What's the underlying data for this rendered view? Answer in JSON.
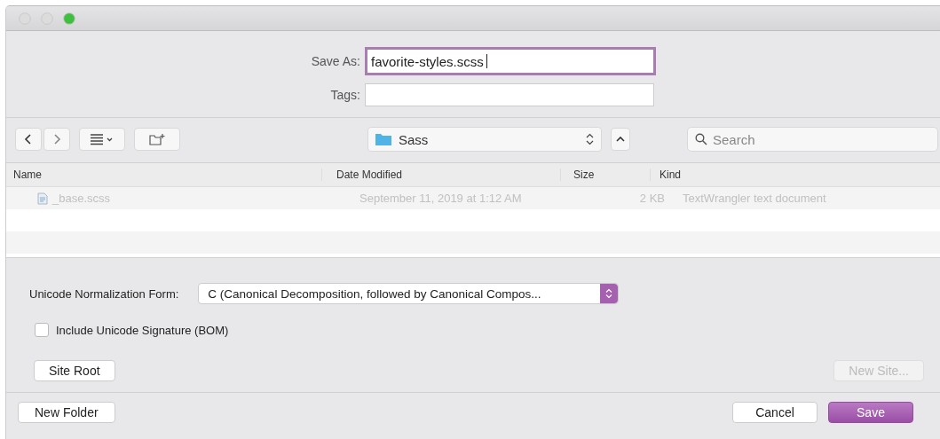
{
  "window": {
    "controls": [
      {
        "active": false
      },
      {
        "active": false
      },
      {
        "active": true
      }
    ]
  },
  "save_as": {
    "label": "Save As:",
    "value": "favorite-styles.scss",
    "focused": true
  },
  "tags": {
    "label": "Tags:"
  },
  "location": {
    "folder": "Sass"
  },
  "search": {
    "placeholder": "Search"
  },
  "table": {
    "columns": [
      "Name",
      "Date Modified",
      "Size",
      "Kind"
    ],
    "rows": [
      {
        "name": "_base.scss",
        "date": "September 11, 2019 at 1:12 AM",
        "size": "2 KB",
        "kind": "TextWrangler text document",
        "disabled": true
      }
    ]
  },
  "encoding": {
    "label": "Unicode Normalization Form:",
    "value": "C (Canonical Decomposition, followed by Canonical Compos..."
  },
  "bom": {
    "label": "Include Unicode Signature (BOM)",
    "checked": false
  },
  "buttons": [
    {
      "label": "Site Root",
      "kind": "site-root",
      "disabled": false
    },
    {
      "label": "New Site...",
      "kind": "new-site",
      "disabled": true
    },
    {
      "label": "New Folder",
      "kind": "new-folder",
      "disabled": false
    },
    {
      "label": "Cancel",
      "kind": "cancel",
      "disabled": false
    },
    {
      "label": "Save",
      "kind": "save",
      "disabled": false
    }
  ]
}
